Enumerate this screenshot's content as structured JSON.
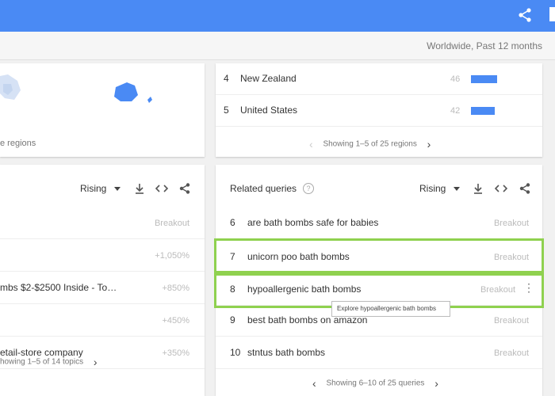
{
  "header": {
    "share_icon": "share-icon",
    "flag_icon": "bookmark-icon"
  },
  "filters": {
    "text": "Worldwide, Past 12 months"
  },
  "map": {
    "link_partial": "e regions",
    "accent": "#4a8af4"
  },
  "regions": {
    "rows": [
      {
        "num": "4",
        "name": "New Zealand",
        "value": "46",
        "score": 46
      },
      {
        "num": "5",
        "name": "United States",
        "value": "42",
        "score": 42
      }
    ],
    "pager": "Showing 1–5 of 25 regions"
  },
  "topics": {
    "select": "Rising",
    "rows": [
      {
        "text": "",
        "value": "Breakout"
      },
      {
        "text": "",
        "value": "+1,050%"
      },
      {
        "text": "mbs $2-$2500 Inside - To…",
        "value": "+850%"
      },
      {
        "text": "",
        "value": "+450%"
      },
      {
        "text": "etail-store company",
        "value": "+350%"
      }
    ],
    "pager": "howing 1–5 of 14 topics"
  },
  "queries": {
    "title": "Related queries",
    "help": "?",
    "select": "Rising",
    "rows": [
      {
        "num": "6",
        "text": "are bath bombs safe for babies",
        "value": "Breakout"
      },
      {
        "num": "7",
        "text": "unicorn poo bath bombs",
        "value": "Breakout"
      },
      {
        "num": "8",
        "text": "hypoallergenic bath bombs",
        "value": "Breakout"
      },
      {
        "num": "9",
        "text": "best bath bombs on amazon",
        "value": "Breakout"
      },
      {
        "num": "10",
        "text": "stntus bath bombs",
        "value": "Breakout"
      }
    ],
    "pager": "Showing 6–10 of 25 queries",
    "tooltip": "Explore hypoallergenic bath bombs",
    "highlight_color": "#8fd14f"
  }
}
